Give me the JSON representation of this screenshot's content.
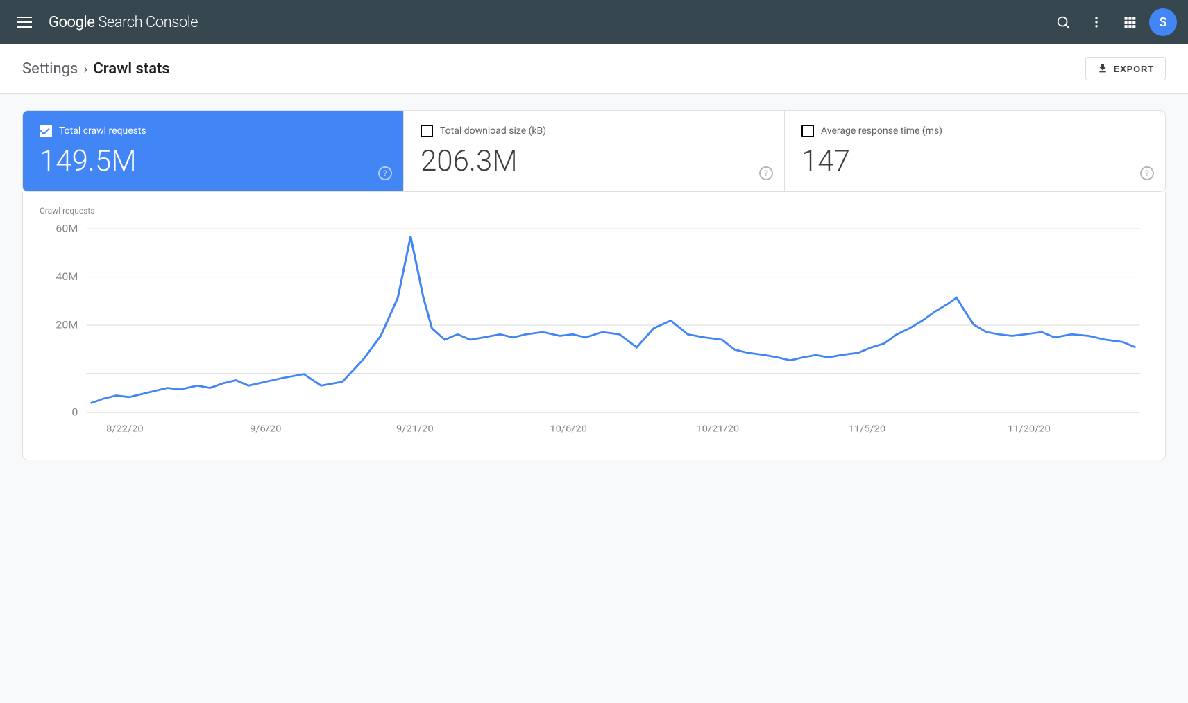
{
  "header": {
    "title_google": "Google",
    "title_rest": " Search Console",
    "avatar_letter": "S"
  },
  "breadcrumb": {
    "settings_label": "Settings",
    "separator": "›",
    "current_label": "Crawl stats"
  },
  "toolbar": {
    "export_label": "EXPORT"
  },
  "stats": {
    "cards": [
      {
        "id": "crawl_requests",
        "label": "Total crawl requests",
        "value": "149.5M",
        "active": true,
        "checked": true
      },
      {
        "id": "download_size",
        "label": "Total download size (kB)",
        "value": "206.3M",
        "active": false,
        "checked": false
      },
      {
        "id": "response_time",
        "label": "Average response time (ms)",
        "value": "147",
        "active": false,
        "checked": false
      }
    ]
  },
  "chart": {
    "y_axis_label": "Crawl requests",
    "y_labels": [
      "60M",
      "40M",
      "20M",
      "0"
    ],
    "x_labels": [
      "8/22/20",
      "9/6/20",
      "9/21/20",
      "10/6/20",
      "10/21/20",
      "11/5/20",
      "11/20/20"
    ],
    "line_color": "#4285f4",
    "grid_color": "#e0e0e0"
  }
}
